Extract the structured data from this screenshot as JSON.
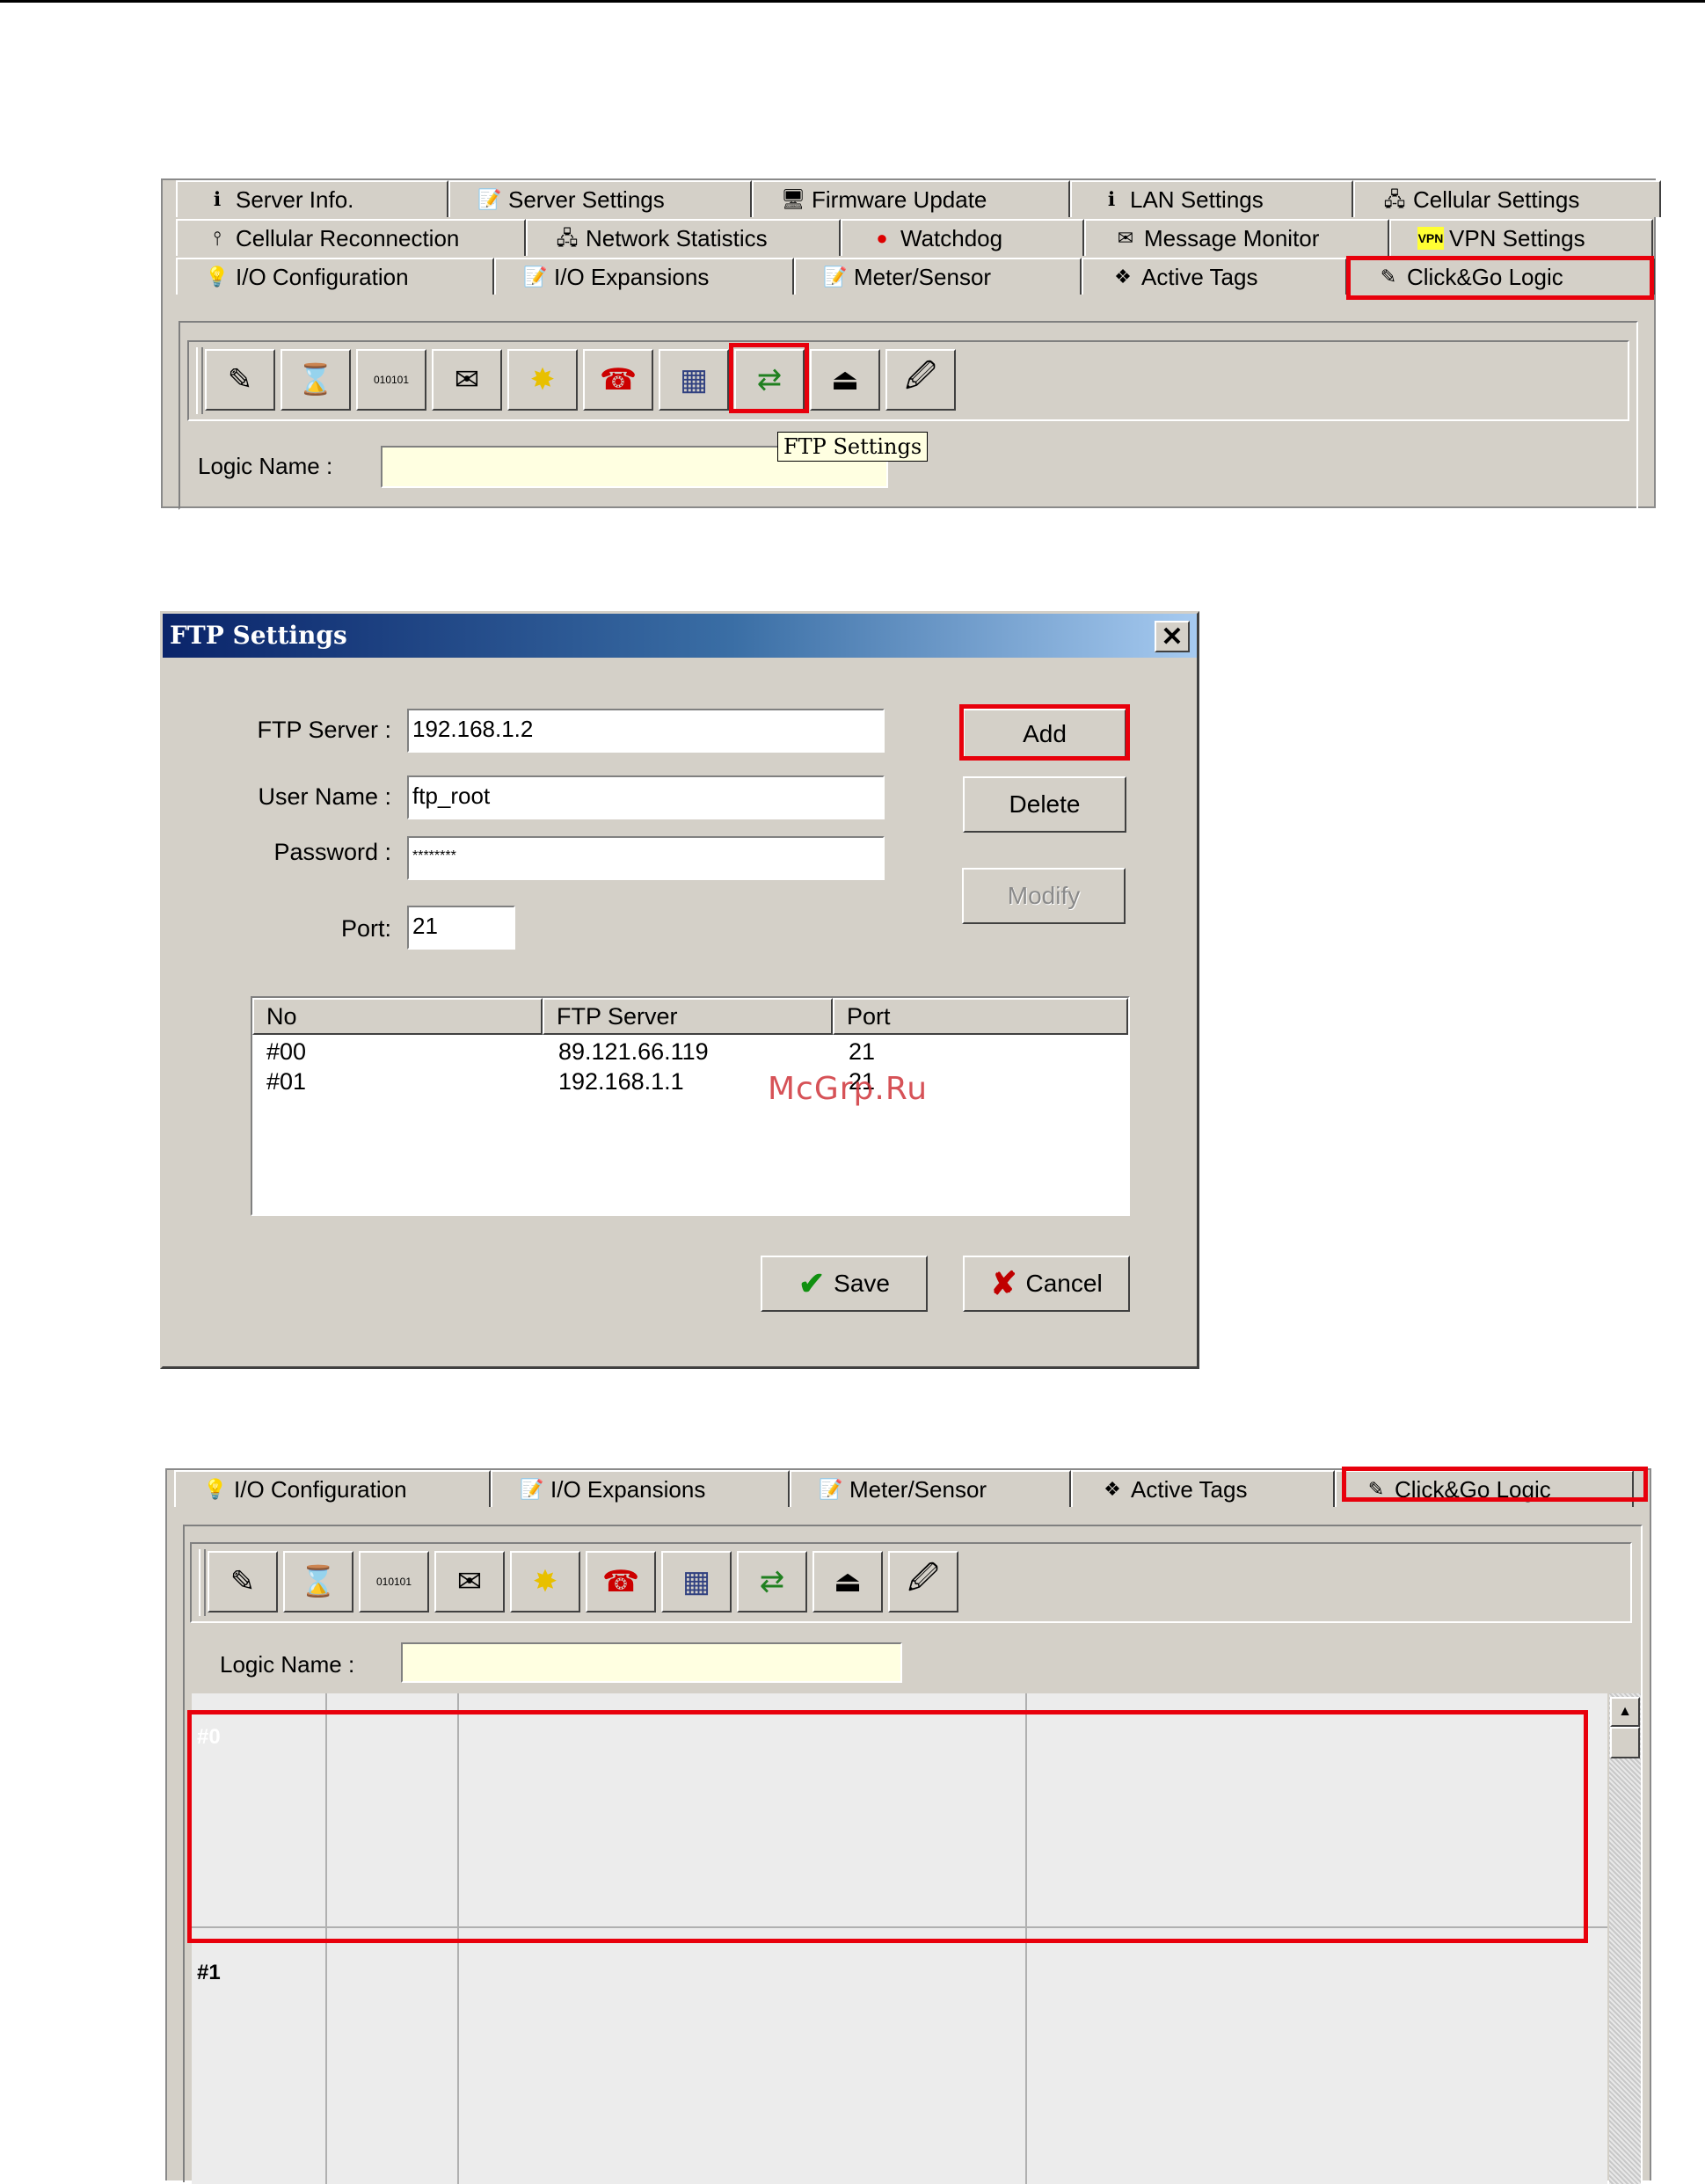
{
  "tabs": {
    "row1": [
      {
        "label": "Server Info.",
        "icon": "info-icon"
      },
      {
        "label": "Server Settings",
        "icon": "settings-icon"
      },
      {
        "label": "Firmware Update",
        "icon": "firmware-icon"
      },
      {
        "label": "LAN Settings",
        "icon": "info-icon"
      },
      {
        "label": "Cellular Settings",
        "icon": "network-icon"
      }
    ],
    "row2": [
      {
        "label": "Cellular Reconnection",
        "icon": "antenna-icon"
      },
      {
        "label": "Network Statistics",
        "icon": "network-icon"
      },
      {
        "label": "Watchdog",
        "icon": "watchdog-icon"
      },
      {
        "label": "Message Monitor",
        "icon": "monitor-icon"
      },
      {
        "label": "VPN Settings",
        "icon": "vpn-icon"
      }
    ],
    "row3": [
      {
        "label": "I/O Configuration",
        "icon": "bulb-icon"
      },
      {
        "label": "I/O Expansions",
        "icon": "settings-icon"
      },
      {
        "label": "Meter/Sensor",
        "icon": "settings-icon"
      },
      {
        "label": "Active Tags",
        "icon": "tags-icon"
      },
      {
        "label": "Click&Go Logic",
        "icon": "logic-icon"
      }
    ]
  },
  "toolbar": {
    "tooltip": "FTP Settings",
    "logic_name_label": "Logic Name :",
    "logic_name_value": ""
  },
  "dialog": {
    "title": "FTP Settings",
    "ftp_server_label": "FTP Server :",
    "ftp_server_value": "192.168.1.2",
    "user_name_label": "User Name :",
    "user_name_value": "ftp_root",
    "password_label": "Password :",
    "password_value": "********",
    "port_label": "Port:",
    "port_value": "21",
    "add_label": "Add",
    "delete_label": "Delete",
    "modify_label": "Modify",
    "save_label": "Save",
    "cancel_label": "Cancel",
    "list": {
      "columns": [
        "No",
        "FTP Server",
        "Port"
      ],
      "rows": [
        [
          "#00",
          "89.121.66.119",
          "21"
        ],
        [
          "#01",
          "192.168.1.1",
          "21"
        ]
      ]
    }
  },
  "grid": {
    "row0_label": "#0",
    "row1_label": "#1"
  },
  "watermark": "McGrp.Ru",
  "colors": {
    "highlight": "#e8000c",
    "titlebar_start": "#0a246a",
    "titlebar_end": "#a6caf0",
    "panel": "#d4d0c8"
  }
}
